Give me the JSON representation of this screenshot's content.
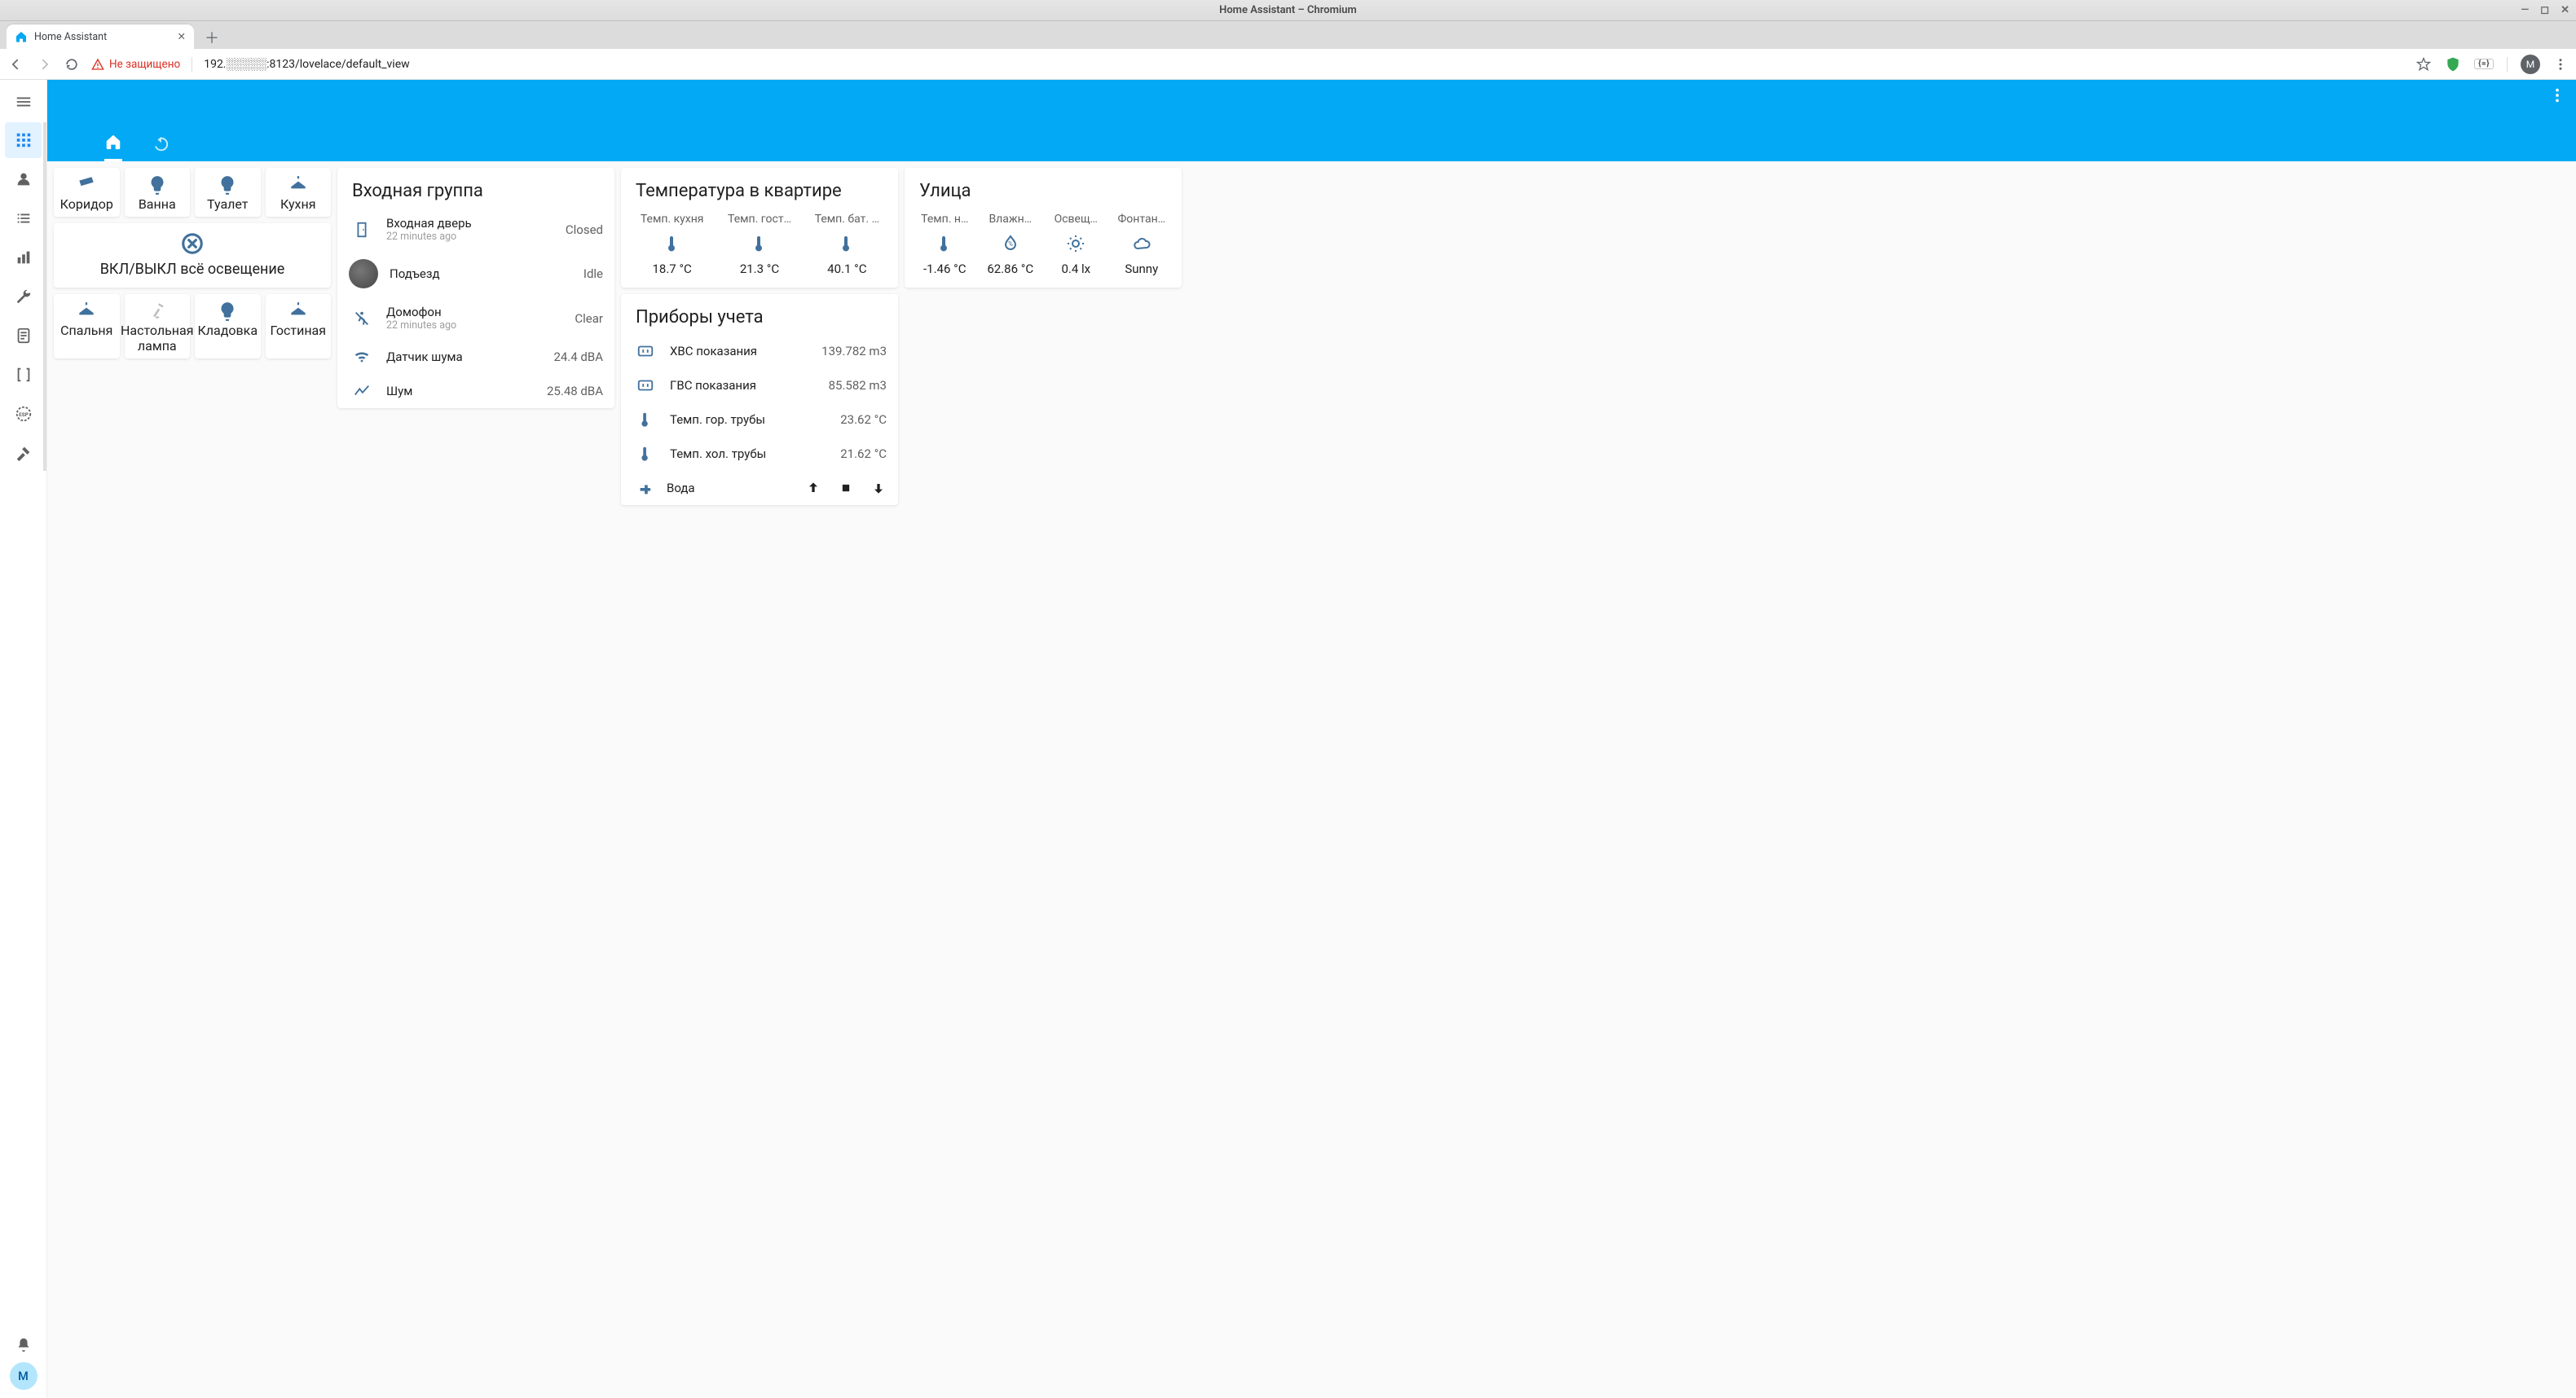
{
  "os": {
    "title": "Home Assistant – Chromium"
  },
  "browser": {
    "tab_title": "Home Assistant",
    "security_label": "Не защищено",
    "url": "192.░░░░░:8123/lovelace/default_view",
    "avatar_initial": "M"
  },
  "sidebar": {
    "user_initial": "M"
  },
  "lights": {
    "row1": [
      {
        "label": "Коридор",
        "icon": "memory"
      },
      {
        "label": "Ванна",
        "icon": "bulb"
      },
      {
        "label": "Туалет",
        "icon": "bulb"
      },
      {
        "label": "Кухня",
        "icon": "ceiling"
      }
    ],
    "master": {
      "label": "ВКЛ/ВЫКЛ всё освещение"
    },
    "row2": [
      {
        "label": "Спальня",
        "icon": "ceiling"
      },
      {
        "label": "Настольная лампа",
        "icon": "desk",
        "dim": true
      },
      {
        "label": "Кладовка",
        "icon": "bulb"
      },
      {
        "label": "Гостиная",
        "icon": "ceiling"
      }
    ]
  },
  "entrance": {
    "title": "Входная группа",
    "items": [
      {
        "name": "Входная дверь",
        "secondary": "22 minutes ago",
        "value": "Closed",
        "icon": "door"
      },
      {
        "name": "Подъезд",
        "secondary": "",
        "value": "Idle",
        "icon": "avatar"
      },
      {
        "name": "Домофон",
        "secondary": "22 minutes ago",
        "value": "Clear",
        "icon": "motion-off"
      },
      {
        "name": "Датчик шума",
        "secondary": "",
        "value": "24.4 dBA",
        "icon": "wifi"
      },
      {
        "name": "Шум",
        "secondary": "",
        "value": "25.48 dBA",
        "icon": "chart"
      }
    ]
  },
  "temp": {
    "title": "Температура в квартире",
    "items": [
      {
        "label": "Темп. кухня",
        "value": "18.7 °C",
        "icon": "thermometer"
      },
      {
        "label": "Темп. гост…",
        "value": "21.3 °C",
        "icon": "thermometer"
      },
      {
        "label": "Темп. бат. …",
        "value": "40.1 °C",
        "icon": "thermometer"
      }
    ]
  },
  "meters": {
    "title": "Приборы учета",
    "items": [
      {
        "name": "ХВС показания",
        "value": "139.782 m3",
        "icon": "counter"
      },
      {
        "name": "ГВС показания",
        "value": "85.582 m3",
        "icon": "counter"
      },
      {
        "name": "Темп. гор. трубы",
        "value": "23.62 °C",
        "icon": "thermometer"
      },
      {
        "name": "Темп. хол. трубы",
        "value": "21.62 °C",
        "icon": "thermometer"
      }
    ],
    "water": {
      "name": "Вода"
    }
  },
  "street": {
    "title": "Улица",
    "items": [
      {
        "label": "Темп. н…",
        "value": "-1.46 °C",
        "icon": "thermometer"
      },
      {
        "label": "Влажн…",
        "value": "62.86 °C",
        "icon": "water-percent"
      },
      {
        "label": "Освещ…",
        "value": "0.4 lx",
        "icon": "brightness"
      },
      {
        "label": "Фонтан…",
        "value": "Sunny",
        "icon": "cloud"
      }
    ]
  }
}
